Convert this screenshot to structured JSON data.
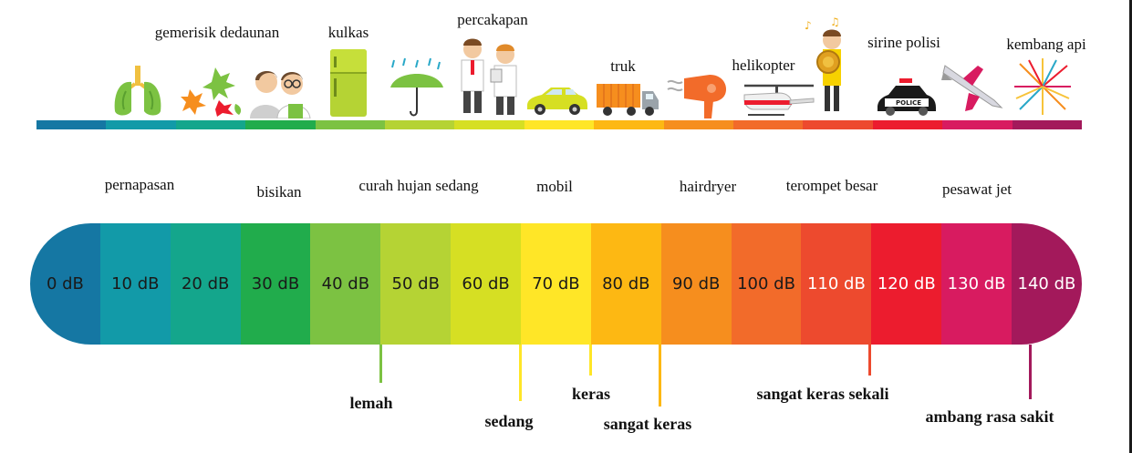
{
  "sources_top": [
    {
      "id": "gemerisik",
      "text": "gemerisik dedaunan"
    },
    {
      "id": "kulkas",
      "text": "kulkas"
    },
    {
      "id": "percakapan",
      "text": "percakapan"
    },
    {
      "id": "truk",
      "text": "truk"
    },
    {
      "id": "helikopter",
      "text": "helikopter"
    },
    {
      "id": "sirine",
      "text": "sirine polisi"
    },
    {
      "id": "kembang",
      "text": "kembang api"
    }
  ],
  "sources_mid": [
    {
      "id": "pernapasan",
      "text": "pernapasan"
    },
    {
      "id": "bisikan",
      "text": "bisikan"
    },
    {
      "id": "hujan",
      "text": "curah hujan sedang"
    },
    {
      "id": "mobil",
      "text": "mobil"
    },
    {
      "id": "hairdryer",
      "text": "hairdryer"
    },
    {
      "id": "terompet",
      "text": "terompet besar"
    },
    {
      "id": "pesawat",
      "text": "pesawat jet"
    }
  ],
  "scale": [
    {
      "label": "0 dB",
      "color": "#1577a3",
      "text_color": "#1a1a1a"
    },
    {
      "label": "10 dB",
      "color": "#129aa8",
      "text_color": "#1a1a1a"
    },
    {
      "label": "20 dB",
      "color": "#14a68c",
      "text_color": "#1a1a1a"
    },
    {
      "label": "30 dB",
      "color": "#21ac4c",
      "text_color": "#1a1a1a"
    },
    {
      "label": "40 dB",
      "color": "#7cc242",
      "text_color": "#1a1a1a"
    },
    {
      "label": "50 dB",
      "color": "#b5d334",
      "text_color": "#1a1a1a"
    },
    {
      "label": "60 dB",
      "color": "#d6df23",
      "text_color": "#1a1a1a"
    },
    {
      "label": "70 dB",
      "color": "#ffe627",
      "text_color": "#1a1a1a"
    },
    {
      "label": "80 dB",
      "color": "#fdb813",
      "text_color": "#1a1a1a"
    },
    {
      "label": "90 dB",
      "color": "#f68e1e",
      "text_color": "#1a1a1a"
    },
    {
      "label": "100 dB",
      "color": "#f26b2a",
      "text_color": "#1a1a1a"
    },
    {
      "label": "110 dB",
      "color": "#ed4a2e",
      "text_color": "#ffffff"
    },
    {
      "label": "120 dB",
      "color": "#ec1c2e",
      "text_color": "#ffffff"
    },
    {
      "label": "130 dB",
      "color": "#d81b60",
      "text_color": "#ffffff"
    },
    {
      "label": "140 dB",
      "color": "#a3195b",
      "text_color": "#ffffff"
    }
  ],
  "levels": [
    {
      "id": "lemah",
      "text": "lemah",
      "color": "#7cc242"
    },
    {
      "id": "sedang",
      "text": "sedang",
      "color": "#ffe627"
    },
    {
      "id": "keras",
      "text": "keras",
      "color": "#ffe627"
    },
    {
      "id": "sangat-keras",
      "text": "sangat keras",
      "color": "#fdb813"
    },
    {
      "id": "sangat-keras-sekali",
      "text": "sangat keras sekali",
      "color": "#ed4a2e"
    },
    {
      "id": "ambang",
      "text": "ambang rasa sakit",
      "color": "#a3195b"
    }
  ]
}
